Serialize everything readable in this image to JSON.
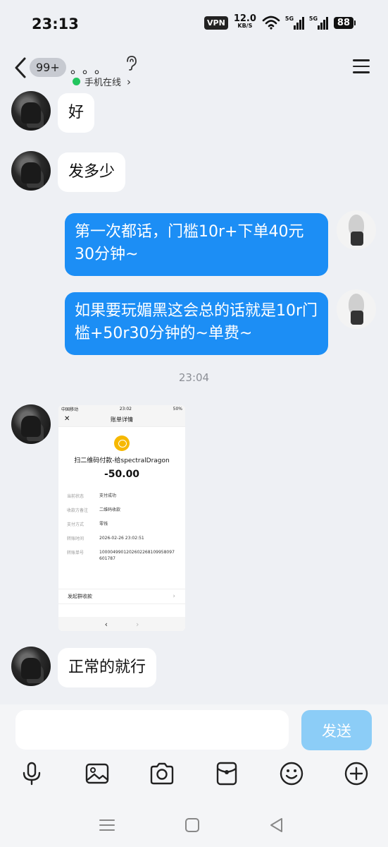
{
  "status_bar": {
    "time": "23:13",
    "vpn": "VPN",
    "net_speed": "12.0",
    "net_speed_unit": "KB/S",
    "sim1": "5G",
    "sim2": "5G",
    "battery": "88"
  },
  "header": {
    "unread_badge": "99+",
    "contact_name": "。。。",
    "status": "手机在线",
    "status_chevron": "›"
  },
  "messages": [
    {
      "from": "other",
      "text": "好"
    },
    {
      "from": "other",
      "text": "发多少"
    },
    {
      "from": "me",
      "text": "第一次都话，门槛10r+下单40元30分钟~"
    },
    {
      "from": "me",
      "text": "如果要玩媚黑这会总的话就是10r门槛+50r30分钟的~单费~"
    },
    {
      "from": "other",
      "text": "正常的就行"
    }
  ],
  "time_separator": "23:04",
  "image_message": {
    "carrier": "中国移动",
    "time": "23:02",
    "battery": "50%",
    "nav_title": "账单详情",
    "close": "✕",
    "payee": "扫二维码付款-给spectralDragon",
    "amount": "-50.00",
    "rows": [
      {
        "k": "当前状态",
        "v": "支付成功"
      },
      {
        "k": "收款方备注",
        "v": "二维码收款"
      },
      {
        "k": "支付方式",
        "v": "零钱"
      },
      {
        "k": "转账时间",
        "v": "2026-02-26 23:02:51"
      },
      {
        "k": "转账单号",
        "v": "1000049901202602268109958097601787"
      }
    ],
    "link": "发起群收款",
    "prev": "‹",
    "next": "›"
  },
  "input": {
    "placeholder": "",
    "send_label": "发送"
  },
  "colors": {
    "my_bubble": "#1c8ef5",
    "other_bubble": "#ffffff",
    "background": "#eef0f4",
    "send_button": "#8ccdf7"
  },
  "toolbar_icons": [
    "microphone-icon",
    "image-icon",
    "camera-icon",
    "red-packet-icon",
    "emoji-icon",
    "plus-icon"
  ]
}
